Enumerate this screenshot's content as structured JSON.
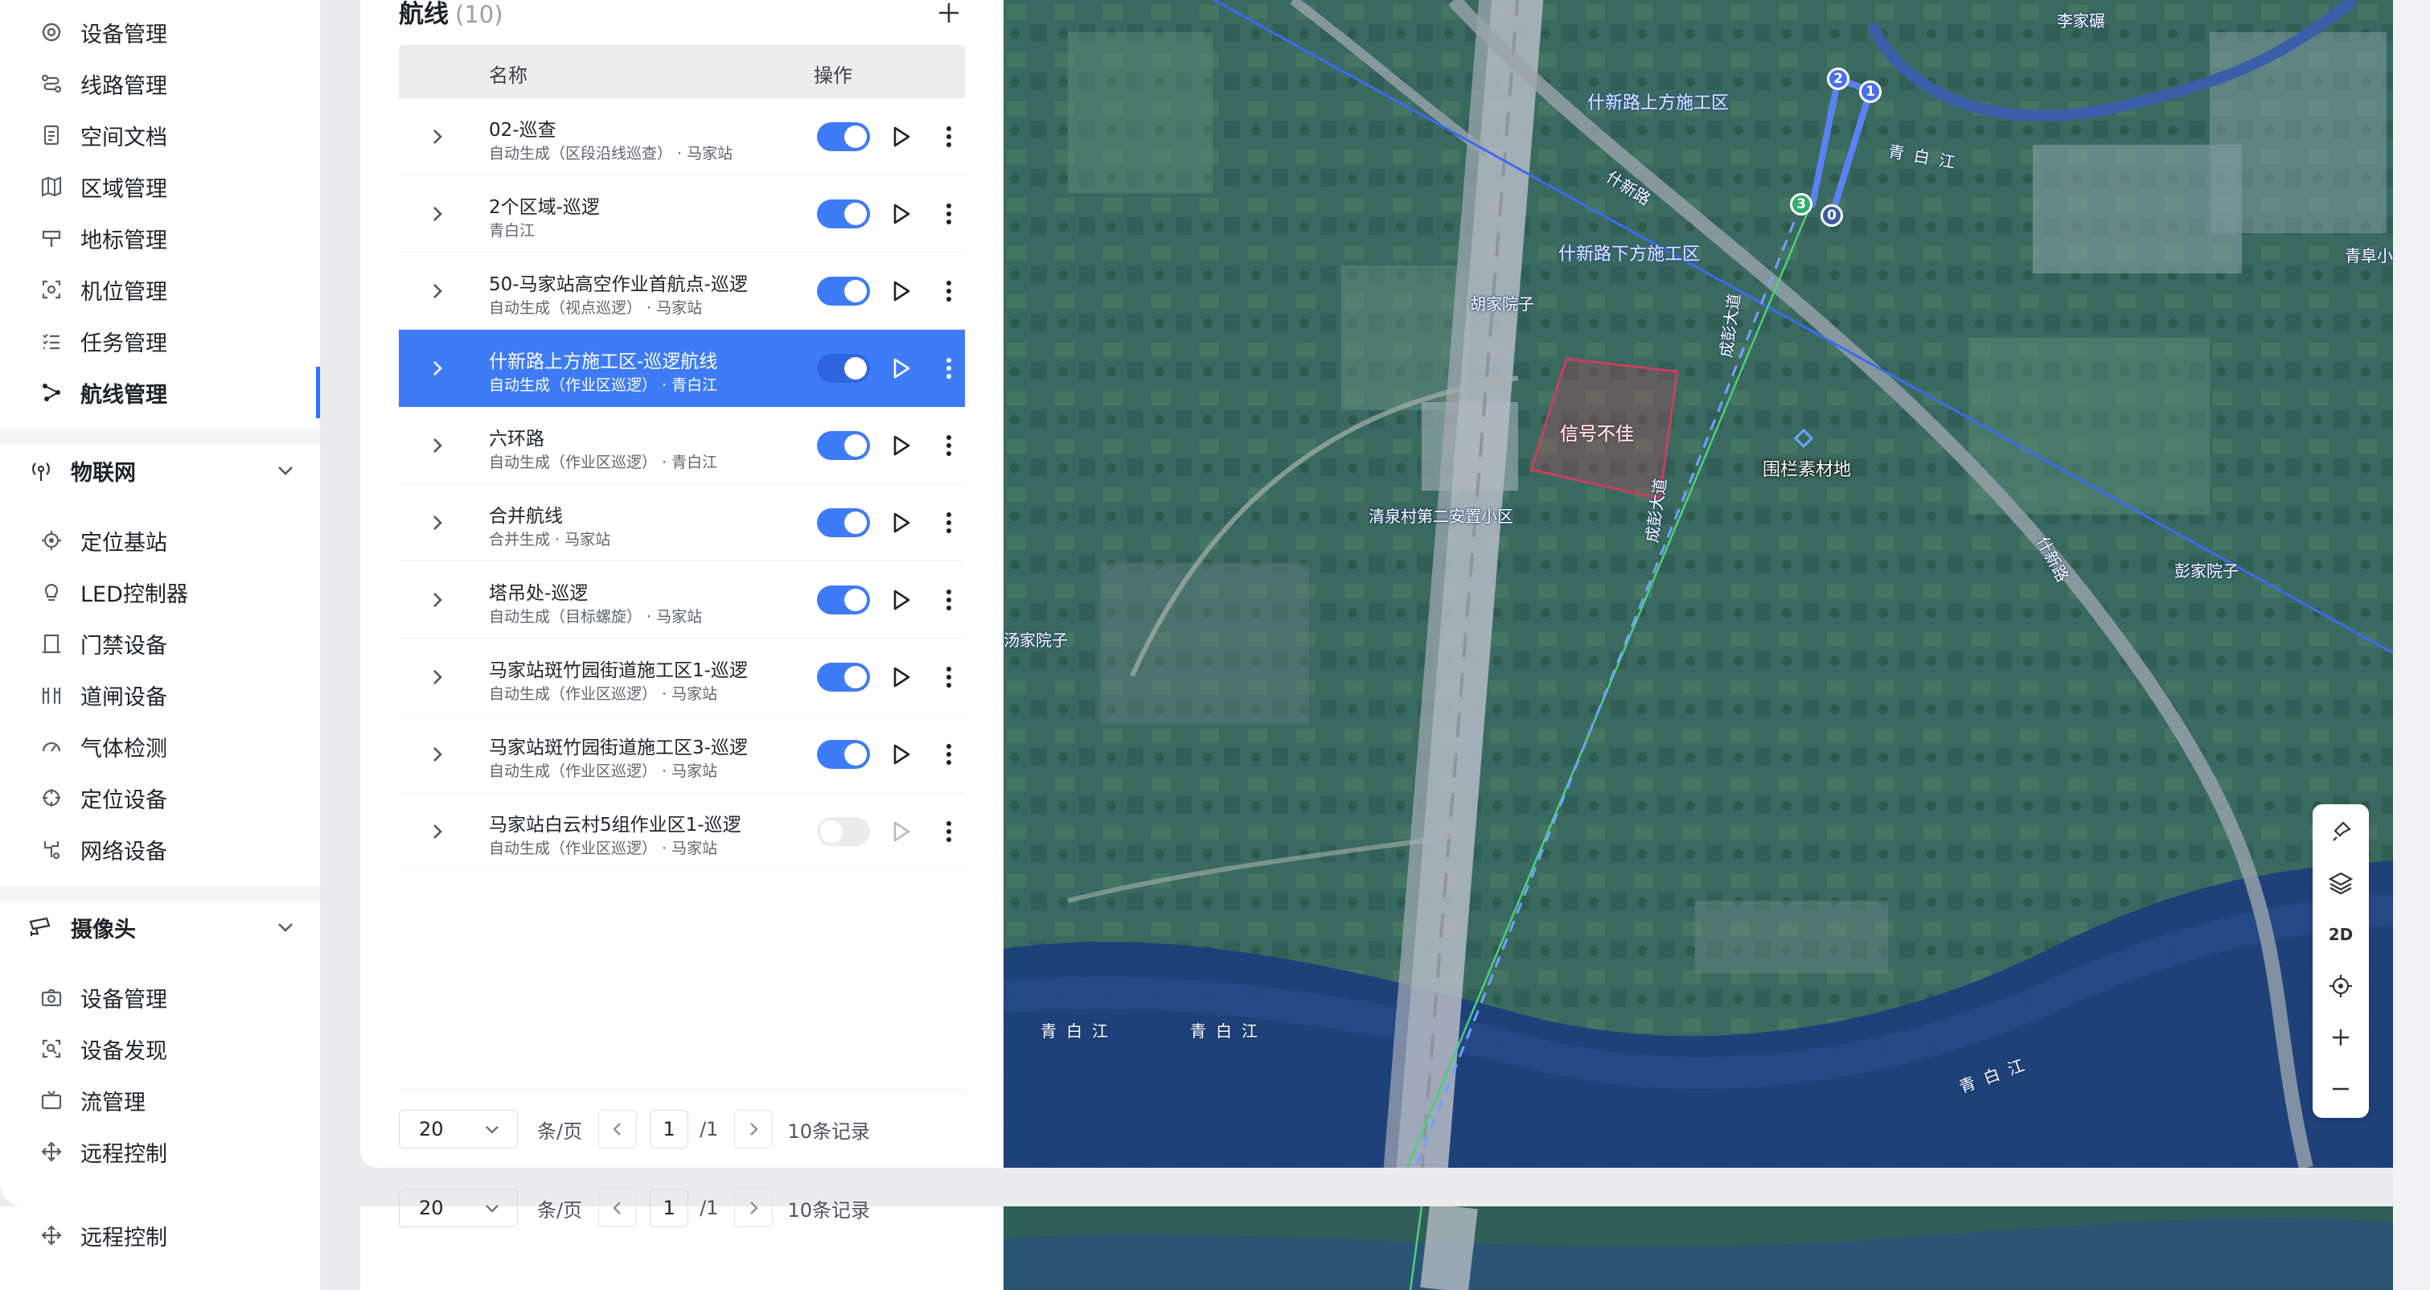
{
  "sidebar": {
    "top_items": [
      {
        "label": "设备管理",
        "icon": "device-icon"
      },
      {
        "label": "线路管理",
        "icon": "route-line-icon"
      },
      {
        "label": "空间文档",
        "icon": "document-icon"
      },
      {
        "label": "区域管理",
        "icon": "area-map-icon"
      },
      {
        "label": "地标管理",
        "icon": "landmark-icon"
      },
      {
        "label": "机位管理",
        "icon": "camera-position-icon"
      },
      {
        "label": "任务管理",
        "icon": "task-list-icon"
      },
      {
        "label": "航线管理",
        "icon": "flight-route-icon",
        "active": true
      }
    ],
    "iot_group": {
      "label": "物联网",
      "items": [
        {
          "label": "定位基站",
          "icon": "base-station-icon"
        },
        {
          "label": "LED控制器",
          "icon": "bulb-icon"
        },
        {
          "label": "门禁设备",
          "icon": "gate-icon"
        },
        {
          "label": "道闸设备",
          "icon": "barrier-icon"
        },
        {
          "label": "气体检测",
          "icon": "gauge-icon"
        },
        {
          "label": "定位设备",
          "icon": "locate-icon"
        },
        {
          "label": "网络设备",
          "icon": "network-icon"
        }
      ]
    },
    "camera_group": {
      "label": "摄像头",
      "items": [
        {
          "label": "设备管理",
          "icon": "camera-icon"
        },
        {
          "label": "设备发现",
          "icon": "scan-icon"
        },
        {
          "label": "流管理",
          "icon": "tv-icon"
        },
        {
          "label": "远程控制",
          "icon": "move-icon"
        }
      ]
    },
    "ghost_item": {
      "label": "远程控制"
    }
  },
  "panel": {
    "title": "航线",
    "count": "(10)",
    "columns": {
      "name": "名称",
      "op": "操作"
    },
    "rows": [
      {
        "name": "02-巡查",
        "sub": "自动生成（区段沿线巡查） · 马家站",
        "enabled": true
      },
      {
        "name": "2个区域-巡逻",
        "sub": "青白江",
        "enabled": true
      },
      {
        "name": "50-马家站高空作业首航点-巡逻",
        "sub": "自动生成（视点巡逻） · 马家站",
        "enabled": true
      },
      {
        "name": "什新路上方施工区-巡逻航线",
        "sub": "自动生成（作业区巡逻） · 青白江",
        "enabled": true,
        "selected": true
      },
      {
        "name": "六环路",
        "sub": "自动生成（作业区巡逻） · 青白江",
        "enabled": true
      },
      {
        "name": "合并航线",
        "sub": "合并生成 · 马家站",
        "enabled": true
      },
      {
        "name": "塔吊处-巡逻",
        "sub": "自动生成（目标螺旋） · 马家站",
        "enabled": true
      },
      {
        "name": "马家站斑竹园街道施工区1-巡逻",
        "sub": "自动生成（作业区巡逻） · 马家站",
        "enabled": true
      },
      {
        "name": "马家站斑竹园街道施工区3-巡逻",
        "sub": "自动生成（作业区巡逻） · 马家站",
        "enabled": true
      },
      {
        "name": "马家站白云村5组作业区1-巡逻",
        "sub": "自动生成（作业区巡逻） · 马家站",
        "enabled": false
      }
    ],
    "pager": {
      "page_size": "20",
      "unit": "条/页",
      "page": "1",
      "total_pages": "/1",
      "records": "10条记录"
    }
  },
  "map": {
    "labels": {
      "construction_upper": "什新路上方施工区",
      "construction_lower": "什新路下方施工区",
      "road_shixin_1": "什新路",
      "road_shixin_2": "什新路",
      "road_chengyu_1": "成彭大道",
      "road_chengyu_2": "成彭大道",
      "village_li": "李家碾",
      "village_hu": "胡家院子",
      "village_tang": "汤家院子",
      "village_peng": "彭家院子",
      "district_qingfu": "青阜小区",
      "community": "清泉村第二安置小区",
      "river_1": "青白江",
      "river_2": "青白江",
      "river_3": "青白江",
      "river_4": "青白江",
      "material_site": "围栏素材地",
      "signal_weak": "信号不佳"
    },
    "waypoints": [
      "0",
      "1",
      "2",
      "3"
    ],
    "tools": {
      "mode": "2D"
    },
    "colors": {
      "route": "#5b82f5",
      "boundary": "#3b6cf0",
      "green_line": "#4cd07a",
      "weak_zone": "#c6405e"
    }
  }
}
